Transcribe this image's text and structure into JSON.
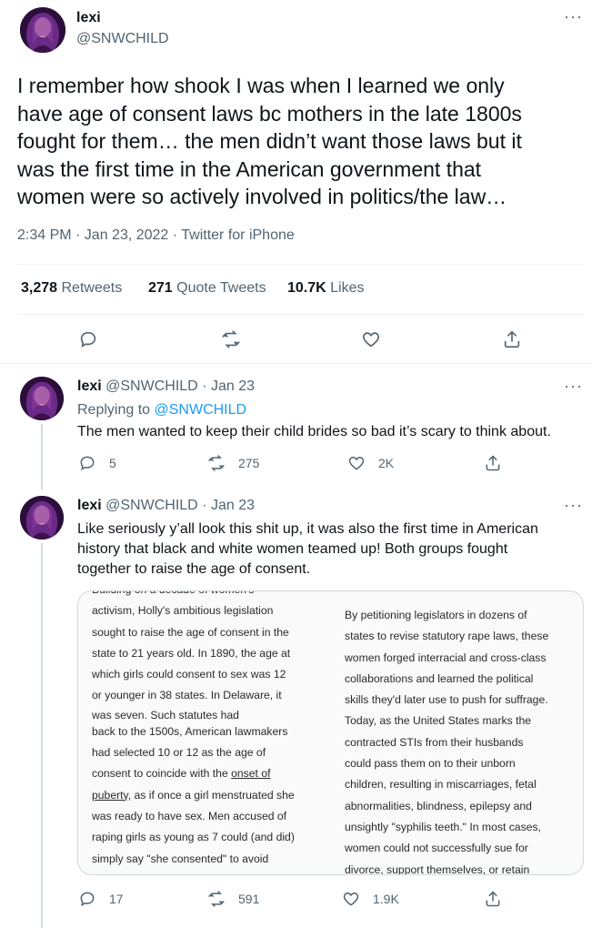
{
  "main_tweet": {
    "author_name": "lexi",
    "author_handle": "@SNWCHILD",
    "more": "···",
    "text_lines": [
      "I remember how shook I was when I learned we only",
      "have age of consent laws bc mothers in the late 1800s",
      "fought for them… the men didn’t want those laws but it",
      "was the first time in the American government that",
      "women were so actively involved in politics/the law…"
    ],
    "timestamp": "2:34 PM · Jan 23, 2022 · Twitter for iPhone",
    "stats": {
      "retweets_count": "3,278",
      "retweets_label": "Retweets",
      "quotes_count": "271",
      "quotes_label": "Quote Tweets",
      "likes_count": "10.7K",
      "likes_label": "Likes"
    }
  },
  "reply_1": {
    "author_name": "lexi",
    "author_handle": "@SNWCHILD",
    "date": "· Jan 23",
    "more": "···",
    "replying_prefix": "Replying to",
    "replying_handle": "@SNWCHILD",
    "text": "The men wanted to keep their child brides so bad it’s scary to think about.",
    "reply_count": "5",
    "retweet_count": "275",
    "like_count": "2K"
  },
  "reply_2": {
    "author_name": "lexi",
    "author_handle": "@SNWCHILD",
    "date": "· Jan 23",
    "more": "···",
    "text_lines": [
      "Like seriously y’all look this shit up, it was also the first time in American",
      "history that black and white women teamed up! Both groups fought",
      "together to raise the age of consent."
    ],
    "reply_count": "17",
    "retweet_count": "591",
    "like_count": "1.9K",
    "image": {
      "left_lines": [
        "Building on a decade of women's",
        "activism, Holly's ambitious legislation",
        "sought to raise the age of consent in the",
        "state to 21 years old. In 1890, the age at",
        "which girls could consent to sex was 12",
        "or younger in 38 states. In Delaware, it",
        "was seven. Such statutes had",
        "back to the 1500s, American lawmakers",
        "had selected 10 or 12 as the age of",
        "consent to coincide with the",
        "onset of",
        "puberty,",
        "as if once a girl menstruated she",
        "was ready to have sex. Men accused of",
        "raping girls as young as 7 could (and did)",
        "simply say \"she consented\" to avoid"
      ],
      "right_lines": [
        "By petitioning legislators in dozens of",
        "states to revise statutory rape laws, these",
        "women forged interracial and cross-class",
        "collaborations and learned the political",
        "skills they'd later use to push for suffrage.",
        "Today, as the United States marks the",
        "contracted STIs from their husbands",
        "could pass them on to their unborn",
        "children, resulting in miscarriages, fetal",
        "abnormalities, blindness, epilepsy and",
        "unsightly \"syphilis teeth.\" In most cases,",
        "women could not successfully sue for",
        "divorce, support themselves, or retain"
      ]
    }
  },
  "colors": {
    "text": "#0f1419",
    "muted": "#536471",
    "link": "#1d9bf0",
    "divider": "#eff3f4"
  },
  "icons": [
    "more-icon",
    "reply-icon",
    "retweet-icon",
    "like-icon",
    "share-icon"
  ]
}
